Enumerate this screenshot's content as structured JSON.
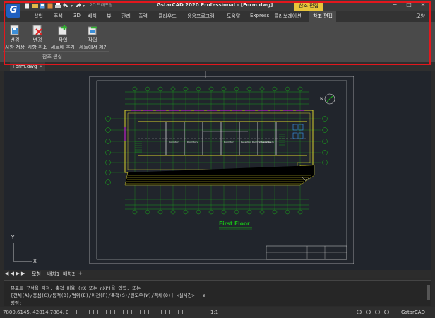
{
  "titlebar": {
    "logo_letter": "G",
    "title": "GstarCAD 2020 Professional - [Form.dwg]",
    "workspace": "2D 드래프팅",
    "context_tab_header": "참조 편집",
    "window_buttons": [
      "−",
      "□",
      "✕"
    ]
  },
  "menu": {
    "tabs": [
      "홈",
      "삽입",
      "주석",
      "3D",
      "배치",
      "뷰",
      "관리",
      "출력",
      "클라우드",
      "응용프로그램",
      "도움말",
      "Express",
      "콜라보레이션",
      "참조 편집"
    ],
    "active": "참조 편집",
    "right_label": "모양"
  },
  "ribbon": {
    "buttons": [
      {
        "line1": "변경",
        "line2": "사항 저장",
        "icon": "save-changes-icon"
      },
      {
        "line1": "변경",
        "line2": "사항 취소",
        "icon": "discard-changes-icon"
      },
      {
        "line1": "작업",
        "line2": "세트에 추가",
        "icon": "add-to-working-set-icon"
      },
      {
        "line1": "작업",
        "line2": "세트에서 제거",
        "icon": "remove-from-working-set-icon"
      }
    ],
    "panel_label": "참조 편집"
  },
  "doc_tab": {
    "name": "Form.dwg",
    "close": "×"
  },
  "drawing": {
    "title": "First Floor",
    "north_label": "N",
    "rooms": [
      "Dormitory",
      "Dormitory",
      "Dormitory",
      "Reception Room Storage Room",
      "Dormitory"
    ],
    "col_labels_top": [
      "⑦",
      "⑧",
      "⑨",
      "⑩",
      "⑪",
      "⑫",
      "⑬",
      "⑭",
      "⑮",
      "⑯",
      "⑰",
      "⑱",
      "⑲",
      "⑳",
      "㉑",
      "㉒",
      "㉓"
    ],
    "row_labels_left": [
      "Ⓐ",
      "Ⓑ",
      "Ⓒ",
      "Ⓓ",
      "Ⓔ",
      "Ⓕ",
      "Ⓖ",
      "Ⓗ"
    ],
    "ucs_x": "X",
    "ucs_y": "Y"
  },
  "layout_tabs": {
    "nav": "◀ ◀ ▶ ▶",
    "model": "모형",
    "layout1": "배치1",
    "layout2": "배치2",
    "add": "+"
  },
  "command": {
    "line1": "뷰포트 구석을 지정, 축척 비율 (nX 또는 nXP)을 입력, 또는",
    "line2": "[전체(A)/중심(C)/동적(D)/범위(E)/이전(P)/축척(S)/윈도우(W)/객체(O)] <실시간>: _e",
    "prompt": "명령:"
  },
  "status": {
    "coords": "7800.6145, 42814.7884, 0",
    "scale": "1:1",
    "app": "GstarCAD"
  },
  "colors": {
    "ribbon_bg": "#4a4a4a",
    "accent_tab": "#e7c43a",
    "highlight_border": "#e3171d",
    "canvas_bg": "#21252c",
    "drawing_green": "#18b818",
    "drawing_yellow": "#d8cf2c",
    "drawing_magenta": "#c020c8"
  }
}
